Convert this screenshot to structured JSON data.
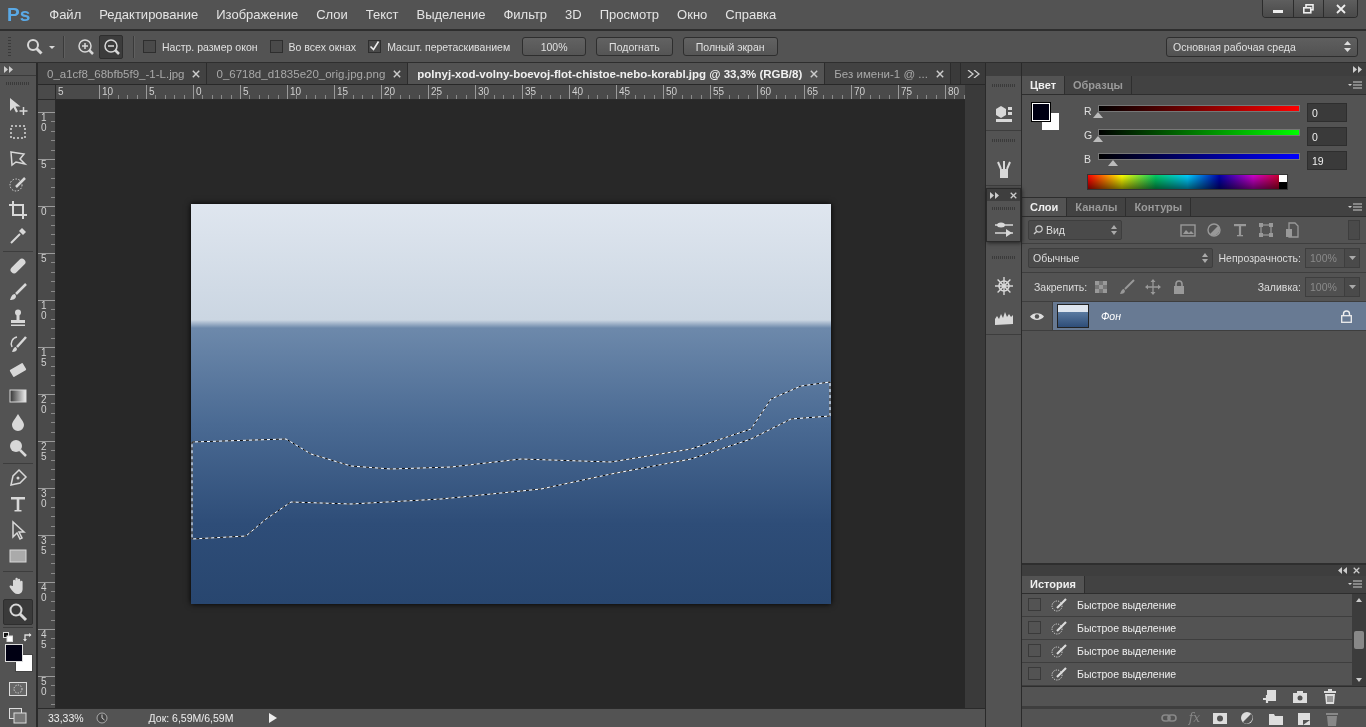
{
  "app_logo": "Ps",
  "menu": [
    "Файл",
    "Редактирование",
    "Изображение",
    "Слои",
    "Текст",
    "Выделение",
    "Фильтр",
    "3D",
    "Просмотр",
    "Окно",
    "Справка"
  ],
  "options_bar": {
    "zoom_modes": [
      {
        "kind": "zoom-in",
        "selected": false
      },
      {
        "kind": "zoom-out",
        "selected": true
      }
    ],
    "checkboxes": [
      {
        "label": "Настр. размер окон",
        "checked": false
      },
      {
        "label": "Во всех окнах",
        "checked": false
      },
      {
        "label": "Масшт. перетаскиванием",
        "checked": true
      }
    ],
    "buttons": [
      "100%",
      "Подогнать",
      "Полный экран"
    ],
    "workspace": "Основная рабочая среда"
  },
  "document_tabs": [
    {
      "label": "0_a1cf8_68bfb5f9_-1-L.jpg",
      "selected": false
    },
    {
      "label": "0_6718d_d1835e20_orig.jpg.png",
      "selected": false
    },
    {
      "label": "polnyj-xod-volny-boevoj-flot-chistoe-nebo-korabl.jpg @ 33,3% (RGB/8)",
      "selected": true
    },
    {
      "label": "Без имени-1 @ ...",
      "selected": false
    }
  ],
  "tool_groups": [
    {
      "tools": [
        {
          "kind": "move",
          "selected": false
        },
        {
          "kind": "marquee",
          "selected": false
        },
        {
          "kind": "lasso",
          "selected": false
        },
        {
          "kind": "quick_select",
          "selected": false
        },
        {
          "kind": "crop",
          "selected": false
        },
        {
          "kind": "eyedropper",
          "selected": false
        }
      ]
    },
    {
      "tools": [
        {
          "kind": "healing",
          "selected": false
        },
        {
          "kind": "brush",
          "selected": false
        },
        {
          "kind": "stamp",
          "selected": false
        },
        {
          "kind": "history_brush",
          "selected": false
        },
        {
          "kind": "eraser",
          "selected": false
        },
        {
          "kind": "gradient",
          "selected": false
        },
        {
          "kind": "blur",
          "selected": false
        },
        {
          "kind": "dodge",
          "selected": false
        }
      ]
    },
    {
      "tools": [
        {
          "kind": "pen",
          "selected": false
        },
        {
          "kind": "type",
          "selected": false
        },
        {
          "kind": "path_select",
          "selected": false
        },
        {
          "kind": "rectangle",
          "selected": false
        }
      ]
    },
    {
      "tools": [
        {
          "kind": "hand",
          "selected": false
        },
        {
          "kind": "zoom",
          "selected": true
        }
      ]
    }
  ],
  "rulers": {
    "horizontal": [
      "5",
      "10",
      "5",
      "0",
      "5",
      "10",
      "15",
      "20",
      "25",
      "30",
      "35",
      "40",
      "45",
      "50",
      "55",
      "60",
      "65",
      "70",
      "75",
      "80"
    ],
    "vertical": [
      "10",
      "5",
      "0",
      "5",
      "10",
      "15",
      "20",
      "25",
      "30",
      "35",
      "40",
      "45",
      "50"
    ]
  },
  "status_bar": {
    "zoom": "33,33%",
    "doc_info": "Док: 6,59M/6,59M"
  },
  "color_panel": {
    "tabs": [
      {
        "label": "Цвет",
        "selected": true
      },
      {
        "label": "Образцы",
        "selected": false
      }
    ],
    "channels": [
      {
        "name": "R",
        "value": "0",
        "level": 0
      },
      {
        "name": "G",
        "value": "0",
        "level": 0
      },
      {
        "name": "B",
        "value": "19",
        "level": 0.075
      }
    ]
  },
  "layers_panel": {
    "tabs": [
      {
        "label": "Слои",
        "selected": true
      },
      {
        "label": "Каналы",
        "selected": false
      },
      {
        "label": "Контуры",
        "selected": false
      }
    ],
    "filter": "Вид",
    "blend_mode": "Обычные",
    "opacity": {
      "label": "Непрозрачность:",
      "value": "100%",
      "disabled": true
    },
    "lock_label": "Закрепить:",
    "fill": {
      "label": "Заливка:",
      "value": "100%",
      "disabled": true
    },
    "layers": [
      {
        "name": "Фон",
        "visible": true,
        "locked": true,
        "selected": true
      }
    ],
    "footer_fx": "fx"
  },
  "history_panel": {
    "tabs": [
      {
        "label": "История",
        "selected": true
      }
    ],
    "steps": [
      {
        "name": "Быстрое выделение",
        "selected": false
      },
      {
        "name": "Быстрое выделение",
        "selected": false
      },
      {
        "name": "Быстрое выделение",
        "selected": false
      },
      {
        "name": "Быстрое выделение",
        "selected": false
      }
    ]
  }
}
